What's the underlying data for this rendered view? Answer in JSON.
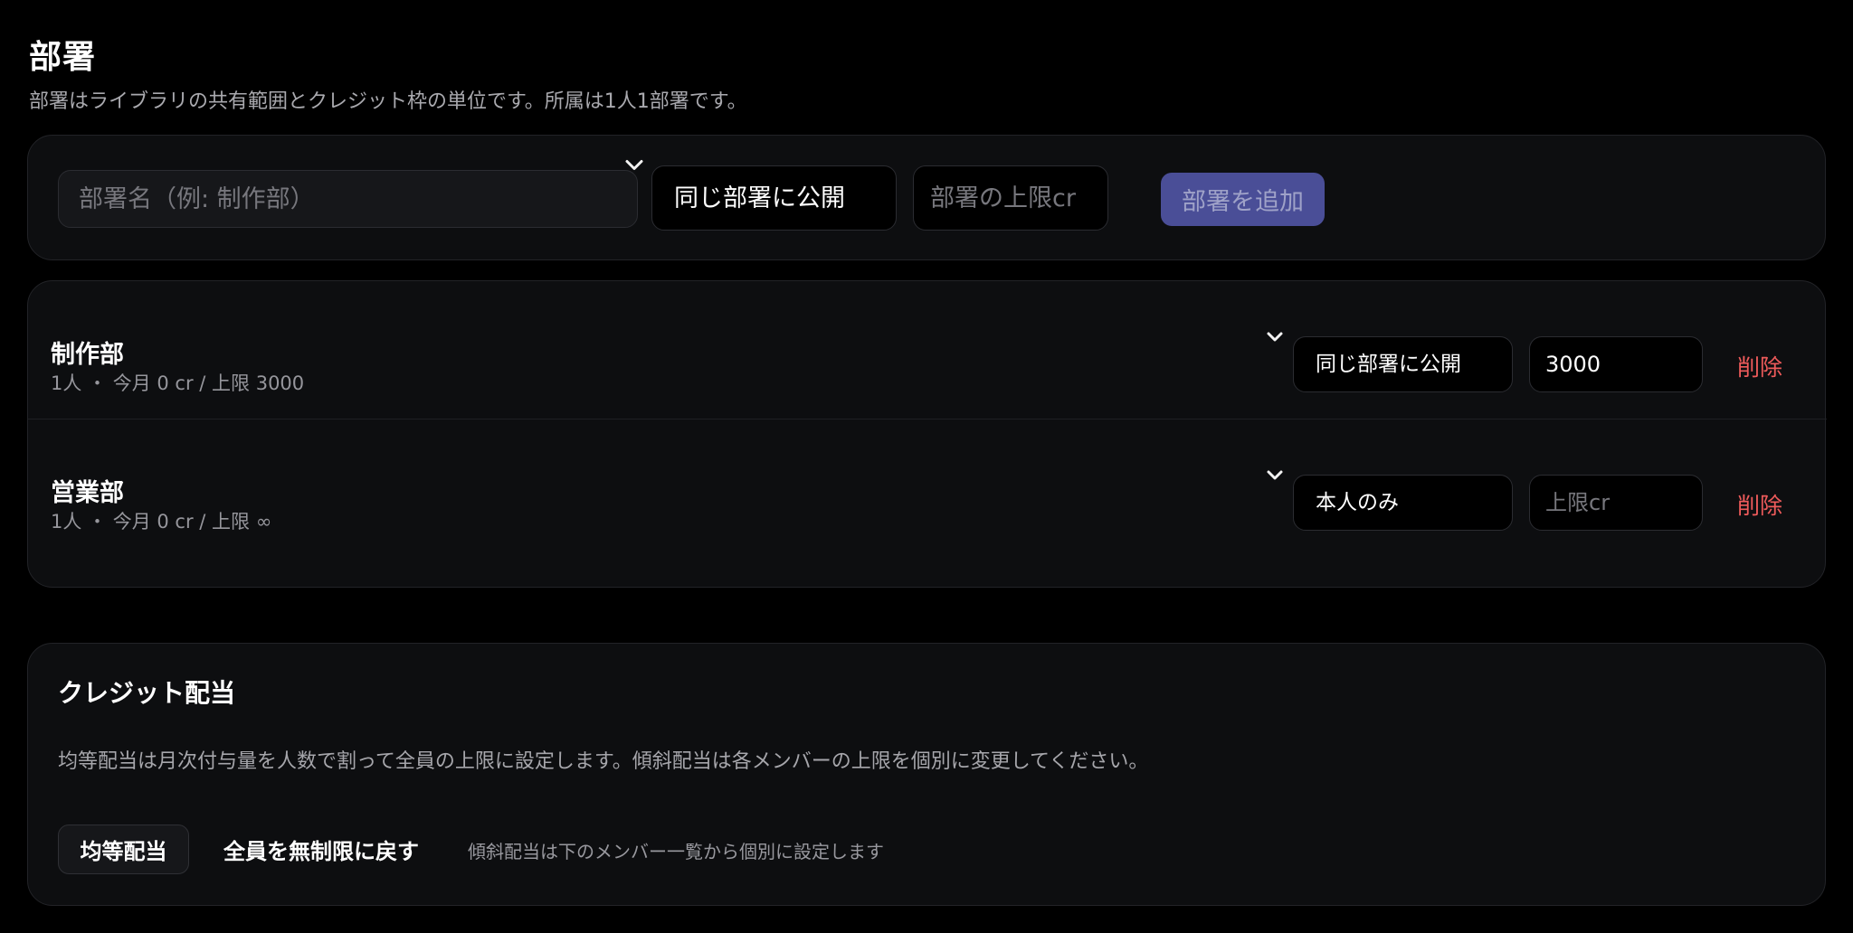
{
  "section": {
    "title": "部署",
    "description": "部署はライブラリの共有範囲とクレジット枠の単位です。所属は1人1部署です。"
  },
  "add_form": {
    "name_placeholder": "部署名（例: 制作部）",
    "visibility_selected": "同じ部署に公開",
    "visibility_options": [
      "同じ部署に公開",
      "本人のみ"
    ],
    "limit_placeholder": "部署の上限cr",
    "add_button": "部署を追加"
  },
  "departments": [
    {
      "name": "制作部",
      "meta": "1人 ・ 今月 0 cr / 上限 3000",
      "visibility": "同じ部署に公開",
      "limit_value": "3000",
      "limit_placeholder": "上限cr",
      "delete_label": "削除"
    },
    {
      "name": "営業部",
      "meta": "1人 ・ 今月 0 cr / 上限 ∞",
      "visibility": "本人のみ",
      "limit_value": "",
      "limit_placeholder": "上限cr",
      "delete_label": "削除"
    }
  ],
  "credit": {
    "title": "クレジット配当",
    "description": "均等配当は月次付与量を人数で割って全員の上限に設定します。傾斜配当は各メンバーの上限を個別に変更してください。",
    "equal_button": "均等配当",
    "reset_button": "全員を無制限に戻す",
    "hint": "傾斜配当は下のメンバー一覧から個別に設定します"
  },
  "colors": {
    "background": "#000000",
    "card": "#0d0e10",
    "accent_button": "#4a4e97",
    "danger": "#ef5b5b"
  },
  "icons": {
    "select_chevron": "chevron-down-icon"
  }
}
